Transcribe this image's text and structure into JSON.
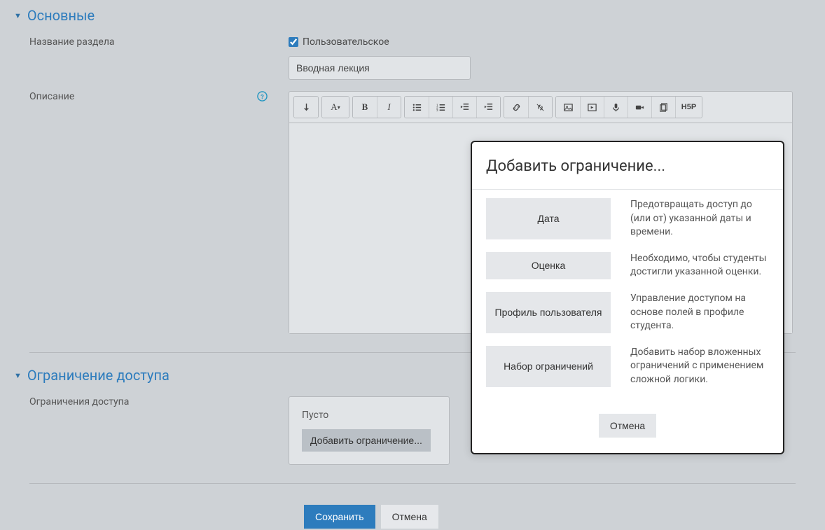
{
  "sections": {
    "main": {
      "title": "Основные"
    },
    "restrict": {
      "title": "Ограничение доступа"
    }
  },
  "labels": {
    "sectionName": "Название раздела",
    "description": "Описание",
    "restrictions": "Ограничения доступа"
  },
  "sectionName": {
    "customCheckboxLabel": "Пользовательское",
    "value": "Вводная лекция"
  },
  "restriction": {
    "empty": "Пусто",
    "addBtn": "Добавить ограничение..."
  },
  "footer": {
    "save": "Сохранить",
    "cancel": "Отмена"
  },
  "modal": {
    "title": "Добавить ограничение...",
    "options": [
      {
        "label": "Дата",
        "desc": "Предотвращать доступ до (или от) указанной даты и времени."
      },
      {
        "label": "Оценка",
        "desc": "Необходимо, чтобы студенты достигли указанной оценки."
      },
      {
        "label": "Профиль пользователя",
        "desc": "Управление доступом на основе полей в профиле студента."
      },
      {
        "label": "Набор ограничений",
        "desc": "Добавить набор вложенных ограничений с применением сложной логики."
      }
    ],
    "cancel": "Отмена"
  },
  "toolbarIcons": {
    "font": "A",
    "bold": "B",
    "italic": "I",
    "hsp": "H5P"
  }
}
